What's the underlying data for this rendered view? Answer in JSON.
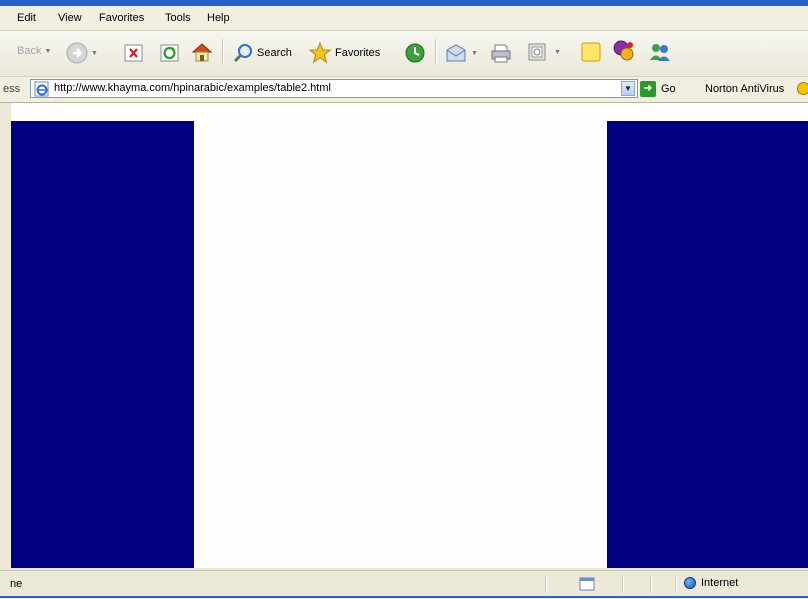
{
  "menu": {
    "items": [
      {
        "label": "Edit"
      },
      {
        "label": "View"
      },
      {
        "label": "Favorites"
      },
      {
        "label": "Tools"
      },
      {
        "label": "Help"
      }
    ]
  },
  "toolbar": {
    "back_label": "Back",
    "search_label": "Search",
    "favorites_label": "Favorites"
  },
  "address": {
    "label": "ess",
    "url": "http://www.khayma.com/hpinarabic/examples/table2.html",
    "go_label": "Go",
    "links_label": "Norton AntiVirus"
  },
  "page": {
    "column_color": "#010080",
    "background_color": "#fefdfb"
  },
  "status": {
    "text": "ne",
    "zone_label": "Internet"
  }
}
